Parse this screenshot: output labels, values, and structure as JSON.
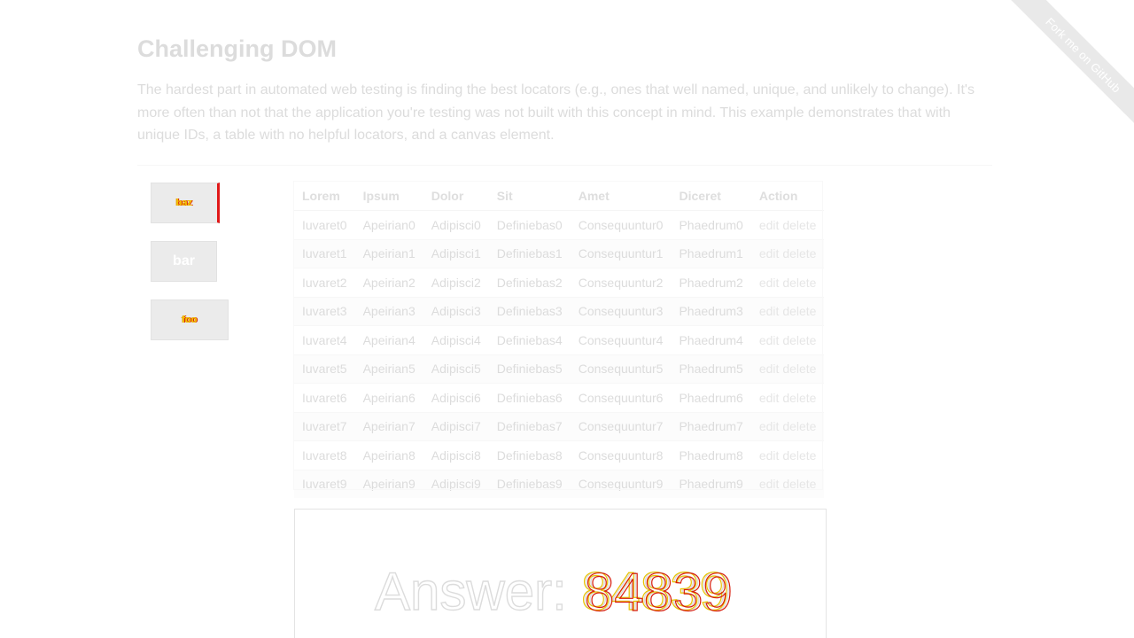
{
  "page": {
    "title": "Challenging DOM",
    "description": "The hardest part in automated web testing is finding the best locators (e.g., ones that well named, unique, and unlikely to change). It's more often than not that the application you're testing was not built with this concept in mind. This example demonstrates that with unique IDs, a table with no helpful locators, and a canvas element."
  },
  "ribbon": {
    "label": "Fork me on GitHub"
  },
  "buttons": [
    {
      "label": "baz",
      "style": "alert",
      "color": "#e01818"
    },
    {
      "label": "bar",
      "style": "plain"
    },
    {
      "label": "foo",
      "style": "success"
    }
  ],
  "table": {
    "headers": [
      "Lorem",
      "Ipsum",
      "Dolor",
      "Sit",
      "Amet",
      "Diceret",
      "Action"
    ],
    "rows": [
      [
        "Iuvaret0",
        "Apeirian0",
        "Adipisci0",
        "Definiebas0",
        "Consequuntur0",
        "Phaedrum0"
      ],
      [
        "Iuvaret1",
        "Apeirian1",
        "Adipisci1",
        "Definiebas1",
        "Consequuntur1",
        "Phaedrum1"
      ],
      [
        "Iuvaret2",
        "Apeirian2",
        "Adipisci2",
        "Definiebas2",
        "Consequuntur2",
        "Phaedrum2"
      ],
      [
        "Iuvaret3",
        "Apeirian3",
        "Adipisci3",
        "Definiebas3",
        "Consequuntur3",
        "Phaedrum3"
      ],
      [
        "Iuvaret4",
        "Apeirian4",
        "Adipisci4",
        "Definiebas4",
        "Consequuntur4",
        "Phaedrum4"
      ],
      [
        "Iuvaret5",
        "Apeirian5",
        "Adipisci5",
        "Definiebas5",
        "Consequuntur5",
        "Phaedrum5"
      ],
      [
        "Iuvaret6",
        "Apeirian6",
        "Adipisci6",
        "Definiebas6",
        "Consequuntur6",
        "Phaedrum6"
      ],
      [
        "Iuvaret7",
        "Apeirian7",
        "Adipisci7",
        "Definiebas7",
        "Consequuntur7",
        "Phaedrum7"
      ],
      [
        "Iuvaret8",
        "Apeirian8",
        "Adipisci8",
        "Definiebas8",
        "Consequuntur8",
        "Phaedrum8"
      ],
      [
        "Iuvaret9",
        "Apeirian9",
        "Adipisci9",
        "Definiebas9",
        "Consequuntur9",
        "Phaedrum9"
      ]
    ],
    "edit_label": "edit",
    "delete_label": "delete"
  },
  "canvas": {
    "answer_prefix": "Answer:",
    "answer_value": "84839",
    "glitch_colors": [
      "#e8c300",
      "#d81c0c"
    ]
  }
}
